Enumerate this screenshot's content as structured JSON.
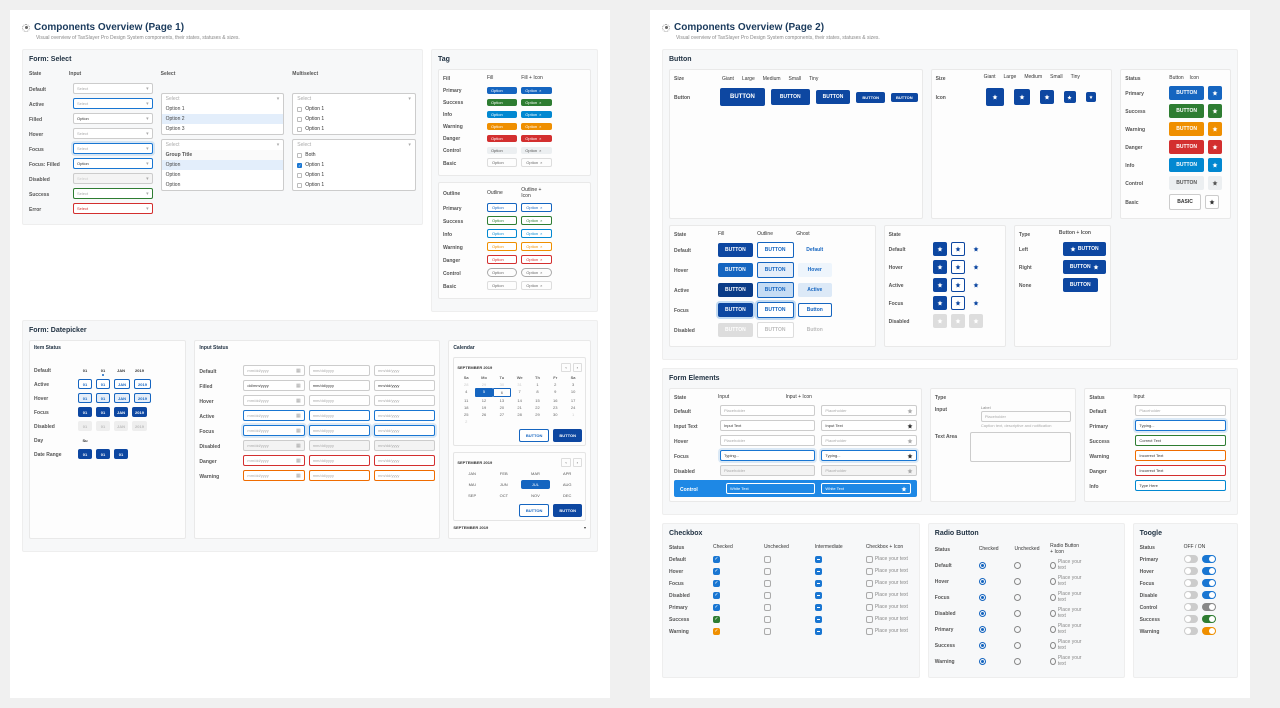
{
  "page1": {
    "title": "Components Overview (Page 1)",
    "subtitle": "Visual overview of TaxSlayer Pro Design System components, their states, statuses & sizes.",
    "form_select": {
      "title": "Form: Select",
      "hdr_state": "State",
      "hdr_input": "Input",
      "hdr_select": "Select",
      "hdr_multi": "Multiselect",
      "states": [
        "Default",
        "Active",
        "Filled",
        "Hover",
        "Focus",
        "Focus: Filled",
        "Disabled",
        "Success",
        "Error"
      ],
      "ph": "Select",
      "filled_val": "Option",
      "panel1": [
        "Option 1",
        "Option 2",
        "Option 3"
      ],
      "panel2_grp": "Group Title",
      "panel2_opts": [
        "Option",
        "Option",
        "Option"
      ],
      "multi_both": "Both",
      "multi_opts": [
        "Option 1",
        "Option 1",
        "Option 1"
      ]
    },
    "tag": {
      "title": "Tag",
      "hdr_fill": "Fill",
      "hdr_fill2": "Fill",
      "hdr_fillicon": "Fill + Icon",
      "hdr_out": "Outline",
      "hdr_outicon": "Outline + Icon",
      "label": "Option",
      "statuses": [
        "Primary",
        "Success",
        "Info",
        "Warning",
        "Danger",
        "Control",
        "Basic"
      ]
    },
    "form_dp": {
      "title": "Form: Datepicker",
      "item_title": "Item Status",
      "input_title": "Input Status",
      "cal_title": "Calendar",
      "item_states": [
        "Default",
        "Active",
        "Hover",
        "Focus",
        "Disabled",
        "Day",
        "Date Range"
      ],
      "day": "01",
      "month": "01",
      "mon": "JAN",
      "year": "2019",
      "su": "Su",
      "input_states": [
        "Default",
        "Filled",
        "Hover",
        "Active",
        "Focus",
        "Disabled",
        "Danger",
        "Warning"
      ],
      "dp_ph": "mm/dd/yyyy",
      "dp_filled": "dd/mm/yyyy",
      "cal_month": "SEPTEMBER 2019",
      "cal_dow": [
        "Sa",
        "Mo",
        "Tu",
        "We",
        "Th",
        "Fr",
        "Sa"
      ],
      "months": [
        "JAN",
        "FEB",
        "MAR",
        "APR",
        "MAI",
        "JUN",
        "JUL",
        "AUG",
        "SEP",
        "OCT",
        "NOV",
        "DEC"
      ],
      "btn_cancel": "BUTTON",
      "btn_ok": "BUTTON"
    }
  },
  "page2": {
    "title": "Components Overview (Page 2)",
    "subtitle": "Visual overview of TaxSlayer Pro Design System components, their states, statuses & sizes.",
    "button": {
      "title": "Button",
      "hdr_size": "Size",
      "sizes": [
        "Giant",
        "Large",
        "Medium",
        "Small",
        "Tiny"
      ],
      "hdr_button": "Button",
      "hdr_icon": "Icon",
      "label": "BUTTON",
      "hdr_state": "State",
      "hdr_fill": "Fill",
      "hdr_out": "Outline",
      "hdr_ghost": "Ghost",
      "states": [
        "Default",
        "Hover",
        "Active",
        "Focus",
        "Disabled"
      ],
      "ghost_labels": [
        "Default",
        "Hover",
        "Active",
        "Button",
        "Button"
      ],
      "hdr_type": "Type",
      "hdr_btn_icon": "Button + Icon",
      "type_rows": [
        "Left",
        "Right",
        "None"
      ],
      "basic_label": "BASIC",
      "hdr_status": "Status",
      "status_col_btn": "Button",
      "status_col_icon": "Icon",
      "statuses": [
        "Primary",
        "Success",
        "Warning",
        "Danger",
        "Info",
        "Control",
        "Basic"
      ]
    },
    "form_el": {
      "title": "Form Elements",
      "hdr_state": "State",
      "hdr_input": "Input",
      "hdr_inputicon": "Input + Icon",
      "hdr_type": "Type",
      "hdr_status": "Status",
      "states": [
        "Default",
        "Input Text",
        "Hover",
        "Focus",
        "Disabled",
        "Control"
      ],
      "ph": "Placeholder",
      "txt": "Input Text",
      "typing": "Typing...",
      "white": "White Text",
      "type_input": "Input",
      "type_textarea": "Text Area",
      "label": "Label",
      "caption": "Caption text, descriptive and notification",
      "status_list": [
        "Default",
        "Primary",
        "Success",
        "Warning",
        "Danger",
        "Info"
      ],
      "status_vals": [
        "Placeholder",
        "Typing...",
        "Correct Text",
        "Incorrect Text",
        "Incorrect Text",
        "Type Here"
      ]
    },
    "checkbox": {
      "title": "Checkbox",
      "hdr_status": "Status",
      "hdr_checked": "Checked",
      "hdr_unchecked": "Unchecked",
      "hdr_int": "Intermediate",
      "hdr_cbicon": "Checkbox + Icon",
      "rows_state": [
        "Default",
        "Hover",
        "Focus",
        "Disabled"
      ],
      "rows_status": [
        "Primary",
        "Success",
        "Warning"
      ],
      "caption": "Place your text"
    },
    "radio": {
      "title": "Radio Button",
      "hdr_status": "Status",
      "hdr_checked": "Checked",
      "hdr_unchecked": "Unchecked",
      "hdr_ricon": "Radio Button + Icon",
      "rows_state": [
        "Default",
        "Hover",
        "Focus",
        "Disabled"
      ],
      "rows_status": [
        "Primary",
        "Success",
        "Warning"
      ],
      "caption": "Place your text"
    },
    "toggle": {
      "title": "Toogle",
      "hdr_status": "Status",
      "hdr_offon": "OFF / ON",
      "rows": [
        "Primary",
        "Hover",
        "Focus",
        "Disable",
        "Control",
        "Success",
        "Warning"
      ]
    }
  }
}
